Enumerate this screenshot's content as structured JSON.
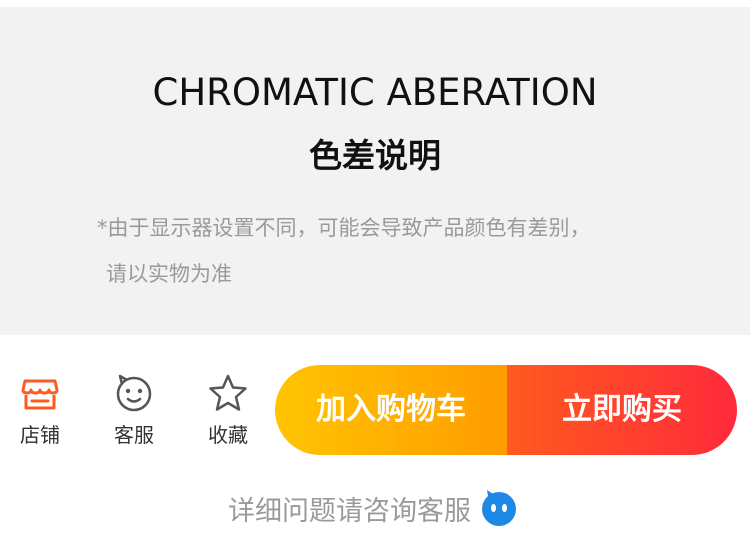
{
  "notice": {
    "title_en": "CHROMATIC ABERATION",
    "title_cn": "色差说明",
    "body_line1": "*由于显示器设置不同，可能会导致产品颜色有差别，",
    "body_line2": "请以实物为准"
  },
  "bottom_bar": {
    "shop_label": "店铺",
    "service_label": "客服",
    "favorite_label": "收藏",
    "add_to_cart_label": "加入购物车",
    "buy_now_label": "立即购买",
    "icons": {
      "shop": "store-icon",
      "service": "smiley-face-icon",
      "favorite": "star-outline-icon"
    }
  },
  "help": {
    "text": "详细问题请咨询客服",
    "icon": "chat-bubble-icon"
  },
  "colors": {
    "shop_icon": "#ff5a1f",
    "cart_gradient": [
      "#ffc402",
      "#ff9c00"
    ],
    "buy_gradient": [
      "#ff5a1f",
      "#ff2a3b"
    ],
    "help_icon": "#1e88e5"
  }
}
